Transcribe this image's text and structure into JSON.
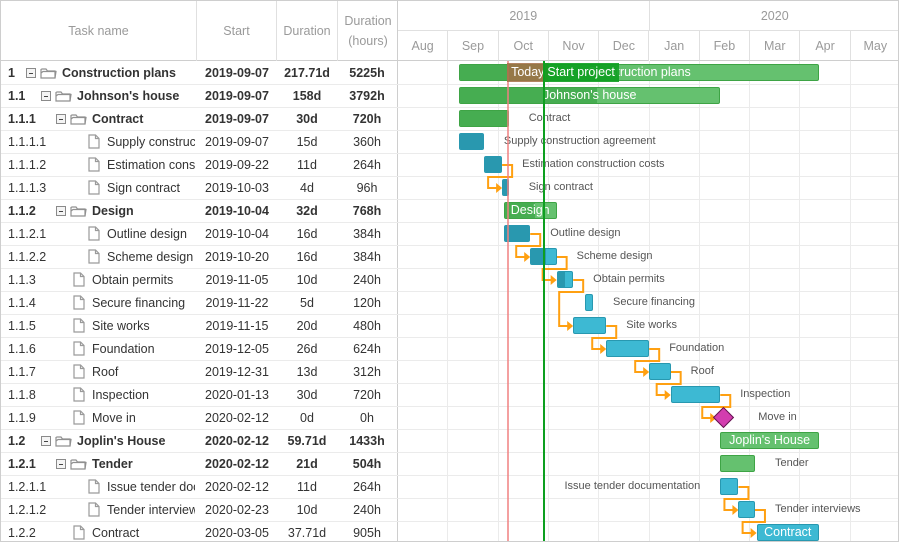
{
  "grid": {
    "columns": [
      {
        "key": "name",
        "label": "Task name"
      },
      {
        "key": "start",
        "label": "Start"
      },
      {
        "key": "duration",
        "label": "Duration"
      },
      {
        "key": "hours",
        "label": "Duration (hours)"
      }
    ],
    "rows": [
      {
        "wbs": "1",
        "name": "Construction plans",
        "start": "2019-09-07",
        "duration": "217.71d",
        "hours": "5225h",
        "level": 0,
        "type": "project",
        "expanded": true
      },
      {
        "wbs": "1.1",
        "name": "Johnson's house",
        "start": "2019-09-07",
        "duration": "158d",
        "hours": "3792h",
        "level": 1,
        "type": "project",
        "expanded": true
      },
      {
        "wbs": "1.1.1",
        "name": "Contract",
        "start": "2019-09-07",
        "duration": "30d",
        "hours": "720h",
        "level": 2,
        "type": "project",
        "expanded": true
      },
      {
        "wbs": "1.1.1.1",
        "name": "Supply construction agreement",
        "start": "2019-09-07",
        "duration": "15d",
        "hours": "360h",
        "level": 3,
        "type": "task"
      },
      {
        "wbs": "1.1.1.2",
        "name": "Estimation construction costs",
        "start": "2019-09-22",
        "duration": "11d",
        "hours": "264h",
        "level": 3,
        "type": "task"
      },
      {
        "wbs": "1.1.1.3",
        "name": "Sign contract",
        "start": "2019-10-03",
        "duration": "4d",
        "hours": "96h",
        "level": 3,
        "type": "task"
      },
      {
        "wbs": "1.1.2",
        "name": "Design",
        "start": "2019-10-04",
        "duration": "32d",
        "hours": "768h",
        "level": 2,
        "type": "project",
        "expanded": true
      },
      {
        "wbs": "1.1.2.1",
        "name": "Outline design",
        "start": "2019-10-04",
        "duration": "16d",
        "hours": "384h",
        "level": 3,
        "type": "task"
      },
      {
        "wbs": "1.1.2.2",
        "name": "Scheme design",
        "start": "2019-10-20",
        "duration": "16d",
        "hours": "384h",
        "level": 3,
        "type": "task"
      },
      {
        "wbs": "1.1.3",
        "name": "Obtain permits",
        "start": "2019-11-05",
        "duration": "10d",
        "hours": "240h",
        "level": 2,
        "type": "task"
      },
      {
        "wbs": "1.1.4",
        "name": "Secure financing",
        "start": "2019-11-22",
        "duration": "5d",
        "hours": "120h",
        "level": 2,
        "type": "task"
      },
      {
        "wbs": "1.1.5",
        "name": "Site works",
        "start": "2019-11-15",
        "duration": "20d",
        "hours": "480h",
        "level": 2,
        "type": "task"
      },
      {
        "wbs": "1.1.6",
        "name": "Foundation",
        "start": "2019-12-05",
        "duration": "26d",
        "hours": "624h",
        "level": 2,
        "type": "task"
      },
      {
        "wbs": "1.1.7",
        "name": "Roof",
        "start": "2019-12-31",
        "duration": "13d",
        "hours": "312h",
        "level": 2,
        "type": "task"
      },
      {
        "wbs": "1.1.8",
        "name": "Inspection",
        "start": "2020-01-13",
        "duration": "30d",
        "hours": "720h",
        "level": 2,
        "type": "task"
      },
      {
        "wbs": "1.1.9",
        "name": "Move in",
        "start": "2020-02-12",
        "duration": "0d",
        "hours": "0h",
        "level": 2,
        "type": "milestone"
      },
      {
        "wbs": "1.2",
        "name": "Joplin's House",
        "start": "2020-02-12",
        "duration": "59.71d",
        "hours": "1433h",
        "level": 1,
        "type": "project",
        "expanded": true
      },
      {
        "wbs": "1.2.1",
        "name": "Tender",
        "start": "2020-02-12",
        "duration": "21d",
        "hours": "504h",
        "level": 2,
        "type": "project",
        "expanded": true
      },
      {
        "wbs": "1.2.1.1",
        "name": "Issue tender documentation",
        "start": "2020-02-12",
        "duration": "11d",
        "hours": "264h",
        "level": 3,
        "type": "task"
      },
      {
        "wbs": "1.2.1.2",
        "name": "Tender interviews",
        "start": "2020-02-23",
        "duration": "10d",
        "hours": "240h",
        "level": 3,
        "type": "task"
      },
      {
        "wbs": "1.2.2",
        "name": "Contract",
        "start": "2020-03-05",
        "duration": "37.71d",
        "hours": "905h",
        "level": 2,
        "type": "task"
      }
    ]
  },
  "timeline": {
    "years": [
      {
        "label": "2019",
        "months": 5
      },
      {
        "label": "2020",
        "months": 5
      }
    ],
    "months": [
      "Aug",
      "Sep",
      "Oct",
      "Nov",
      "Dec",
      "Jan",
      "Feb",
      "Mar",
      "Apr",
      "May"
    ],
    "range_start": "2019-08-01",
    "markers": [
      {
        "label": "Today",
        "date": "2019-10-06",
        "color": "#f08080"
      },
      {
        "label": "Start project",
        "date": "2019-10-28",
        "color": "#0d9f1f"
      }
    ]
  },
  "bars": [
    {
      "row": 0,
      "text": "Construction plans",
      "text_pos": "inside",
      "progress": 0.23
    },
    {
      "row": 1,
      "text": "Johnson's house",
      "text_pos": "inside",
      "progress": 0.53
    },
    {
      "row": 2,
      "text": "Contract",
      "text_pos": "right",
      "progress": 1.0
    },
    {
      "row": 3,
      "text": "Supply construction agreement",
      "text_pos": "right",
      "progress": 1.0
    },
    {
      "row": 4,
      "text": "Estimation construction costs",
      "text_pos": "right",
      "progress": 1.0
    },
    {
      "row": 5,
      "text": "Sign contract",
      "text_pos": "right",
      "progress": 1.0
    },
    {
      "row": 6,
      "text": "Design",
      "text_pos": "inside",
      "progress": 0.6
    },
    {
      "row": 7,
      "text": "Outline design",
      "text_pos": "right",
      "progress": 1.0
    },
    {
      "row": 8,
      "text": "Scheme design",
      "text_pos": "right",
      "progress": 0.6
    },
    {
      "row": 9,
      "text": "Obtain permits",
      "text_pos": "right",
      "progress": 0.5
    },
    {
      "row": 10,
      "text": "Secure financing",
      "text_pos": "right",
      "progress": 0
    },
    {
      "row": 11,
      "text": "Site works",
      "text_pos": "right",
      "progress": 0
    },
    {
      "row": 12,
      "text": "Foundation",
      "text_pos": "right",
      "progress": 0
    },
    {
      "row": 13,
      "text": "Roof",
      "text_pos": "right",
      "progress": 0
    },
    {
      "row": 14,
      "text": "Inspection",
      "text_pos": "right",
      "progress": 0
    },
    {
      "row": 15,
      "text": "Move in",
      "text_pos": "right",
      "progress": 0
    },
    {
      "row": 16,
      "text": "Joplin's House",
      "text_pos": "inside",
      "progress": 0
    },
    {
      "row": 17,
      "text": "Tender",
      "text_pos": "right",
      "progress": 0
    },
    {
      "row": 18,
      "text": "Issue tender documentation",
      "text_pos": "left",
      "progress": 0
    },
    {
      "row": 19,
      "text": "Tender interviews",
      "text_pos": "right",
      "progress": 0
    },
    {
      "row": 20,
      "text": "Contract",
      "text_pos": "inside",
      "progress": 0
    }
  ],
  "links": [
    [
      4,
      5
    ],
    [
      7,
      8
    ],
    [
      8,
      9
    ],
    [
      9,
      11
    ],
    [
      11,
      12
    ],
    [
      12,
      13
    ],
    [
      13,
      14
    ],
    [
      14,
      15
    ],
    [
      18,
      19
    ],
    [
      19,
      20
    ]
  ],
  "colors": {
    "summary_bar": "#65c16f",
    "task_bar": "#3db9d3",
    "milestone": "#d33daf",
    "link": "#ffa011"
  }
}
